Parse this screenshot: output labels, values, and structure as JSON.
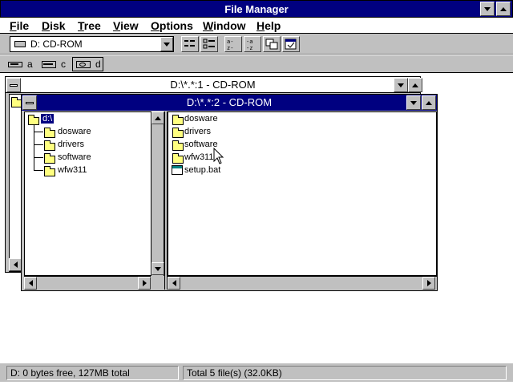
{
  "app": {
    "title": "File Manager"
  },
  "menu": [
    "File",
    "Disk",
    "Tree",
    "View",
    "Options",
    "Window",
    "Help"
  ],
  "menu_hotkeys": [
    "F",
    "D",
    "T",
    "V",
    "O",
    "W",
    "H"
  ],
  "toolbar": {
    "drive_select": "D: CD-ROM"
  },
  "drives": [
    "a",
    "c",
    "d"
  ],
  "window1": {
    "title": "D:\\*.*:1 - CD-ROM"
  },
  "window2": {
    "title": "D:\\*.*:2 - CD-ROM",
    "tree": {
      "root": "d:\\",
      "folders": [
        "dosware",
        "drivers",
        "software",
        "wfw311"
      ]
    },
    "contents": [
      {
        "name": "dosware",
        "type": "folder"
      },
      {
        "name": "drivers",
        "type": "folder"
      },
      {
        "name": "software",
        "type": "folder"
      },
      {
        "name": "wfw311",
        "type": "folder"
      },
      {
        "name": "setup.bat",
        "type": "file"
      }
    ]
  },
  "status": {
    "disk": "D: 0 bytes free,  127MB total",
    "files": "Total 5 file(s) (32.0KB)"
  },
  "colors": {
    "titlebar": "#000080",
    "face": "#c0c0c0",
    "selection": "#000080"
  }
}
